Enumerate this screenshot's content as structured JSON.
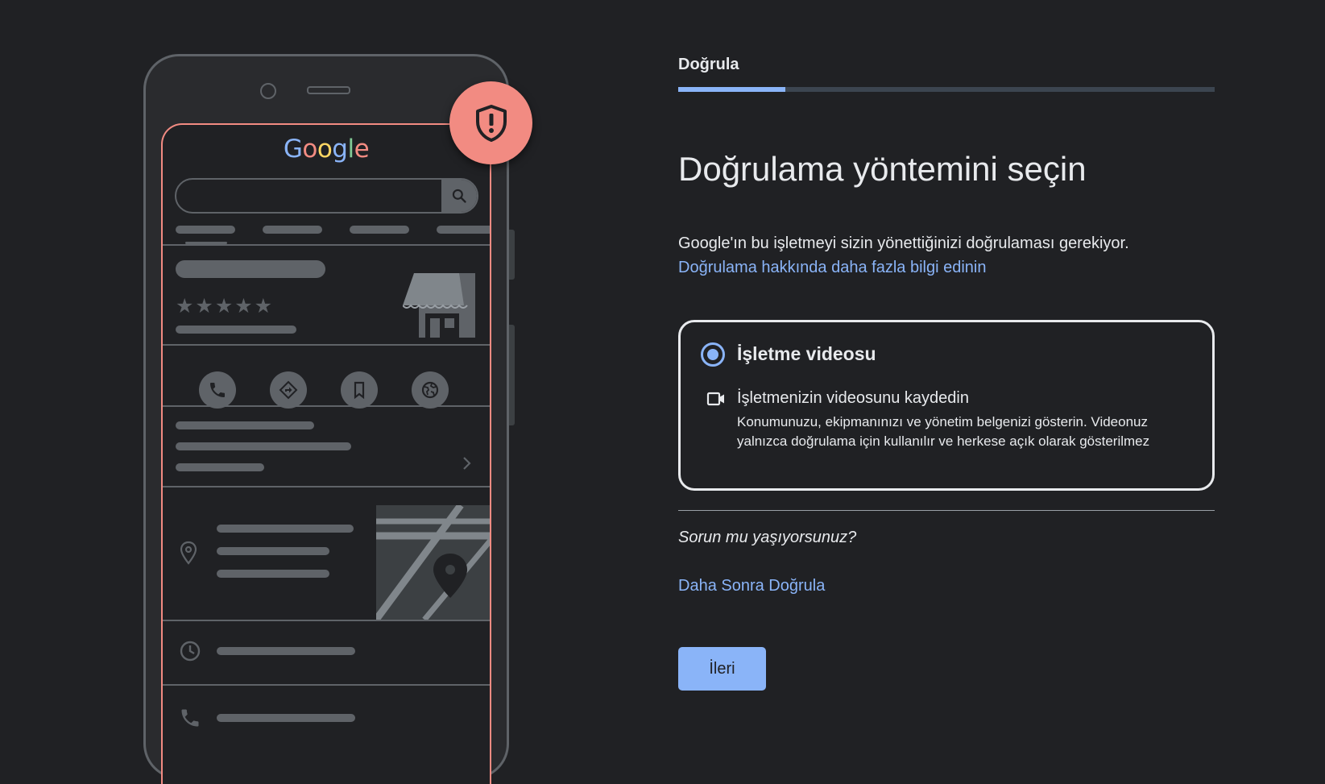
{
  "illustration": {
    "logo": [
      "G",
      "o",
      "o",
      "g",
      "l",
      "e"
    ],
    "stars": "★★★★★",
    "icons": [
      "shield-alert-icon",
      "search-icon",
      "store-icon",
      "phone-icon",
      "directions-icon",
      "bookmark-icon",
      "globe-icon",
      "chevron-right-icon",
      "location-pin-icon",
      "map-pin-icon",
      "clock-icon"
    ]
  },
  "colors": {
    "background": "#202124",
    "accent": "#8ab4f8",
    "badge": "#f28b82",
    "text": "#e8eaed",
    "placeholder": "#5f6368"
  },
  "step": {
    "label": "Doğrula",
    "progress_percent": 20
  },
  "heading": "Doğrulama yöntemini seçin",
  "description": "Google'ın bu işletmeyi sizin yönettiğinizi doğrulaması gerekiyor.",
  "learn_more_link": "Doğrulama hakkında daha fazla bilgi edinin",
  "option": {
    "title": "İşletme videosu",
    "selected": true,
    "subtitle": "İşletmenizin videosunu kaydedin",
    "description": "Konumunuzu, ekipmanınızı ve yönetim belgenizi gösterin. Videonuz yalnızca doğrulama için kullanılır ve herkese açık olarak gösterilmez",
    "icon": "video-camera-icon"
  },
  "trouble_text": "Sorun mu yaşıyorsunuz?",
  "verify_later_link": "Daha Sonra Doğrula",
  "next_button": "İleri"
}
